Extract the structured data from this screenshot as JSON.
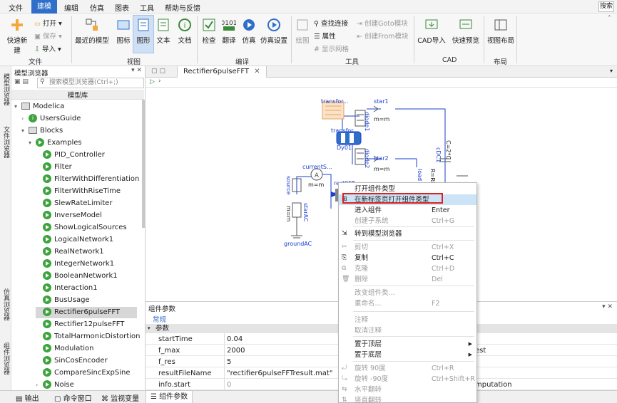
{
  "menu": [
    "文件",
    "建模",
    "编辑",
    "仿真",
    "图表",
    "工具",
    "帮助与反馈"
  ],
  "menu_active": "建模",
  "search_label": "搜索",
  "ribbon": {
    "quick_new": "快速新建",
    "open": "打开",
    "save": "保存",
    "import": "导入",
    "recent_models": "最近的模型",
    "icon": "图标",
    "diagram": "图形",
    "text": "文本",
    "docs": "文档",
    "check": "检查",
    "translate": "翻译",
    "simulate": "仿真",
    "sim_settings": "仿真设置",
    "draw": "绘图",
    "find_connection": "查找连接",
    "properties": "属性",
    "show_grid": "显示网格",
    "create_goto": "创建Goto模块",
    "create_from": "创建From模块",
    "cad_import": "CAD导入",
    "quick_preview": "快速预览",
    "view_layout": "视图布局",
    "group_file": "文件",
    "group_view": "视图",
    "group_compile": "编译",
    "group_tools": "工具",
    "group_cad": "CAD",
    "group_layout": "布局"
  },
  "vtabs": [
    "模型浏览器",
    "文件浏览器",
    "仿真浏览器",
    "组件浏览器"
  ],
  "browser": {
    "title": "模型浏览器",
    "search_placeholder": "搜索模型浏览器(Ctrl+;)",
    "lib_header": "模型库",
    "items": [
      {
        "label": "Modelica",
        "kind": "root"
      },
      {
        "label": "UsersGuide",
        "kind": "info"
      },
      {
        "label": "Blocks",
        "kind": "pkg"
      },
      {
        "label": "Examples",
        "kind": "play"
      },
      {
        "label": "PID_Controller",
        "kind": "play"
      },
      {
        "label": "Filter",
        "kind": "play"
      },
      {
        "label": "FilterWithDifferentiation",
        "kind": "play"
      },
      {
        "label": "FilterWithRiseTime",
        "kind": "play"
      },
      {
        "label": "SlewRateLimiter",
        "kind": "play"
      },
      {
        "label": "InverseModel",
        "kind": "play"
      },
      {
        "label": "ShowLogicalSources",
        "kind": "play"
      },
      {
        "label": "LogicalNetwork1",
        "kind": "play"
      },
      {
        "label": "RealNetwork1",
        "kind": "play"
      },
      {
        "label": "IntegerNetwork1",
        "kind": "play"
      },
      {
        "label": "BooleanNetwork1",
        "kind": "play"
      },
      {
        "label": "Interaction1",
        "kind": "play"
      },
      {
        "label": "BusUsage",
        "kind": "play"
      },
      {
        "label": "Rectifier6pulseFFT",
        "kind": "play"
      },
      {
        "label": "Rectifier12pulseFFT",
        "kind": "play"
      },
      {
        "label": "TotalHarmonicDistortion",
        "kind": "play"
      },
      {
        "label": "Modulation",
        "kind": "play"
      },
      {
        "label": "SinCosEncoder",
        "kind": "play"
      },
      {
        "label": "CompareSincExpSine",
        "kind": "play"
      },
      {
        "label": "Noise",
        "kind": "play"
      }
    ]
  },
  "editor": {
    "tab": "Rectifier6pulseFFT"
  },
  "diagram": {
    "transformer1": "transfor...",
    "transformer2": "transfor...",
    "dy01": "Dy01",
    "star1": "star1",
    "star2": "star2",
    "m_m_1": "m=m",
    "m_m_2": "m=m",
    "m_m_3": "m=m",
    "m_m_4": "m=m",
    "diode1": "diode1",
    "diode2": "diode2",
    "current": "currentS...",
    "source": "source",
    "starAC": "starAC",
    "groundAC": "groundAC",
    "rectFFT": "rectFFT",
    "load": "load",
    "rerl": "R=RL",
    "cdc1": "cDC1",
    "c2c": "C=2*C"
  },
  "params": {
    "header": "组件参数",
    "subtab": "常规",
    "section": "参数",
    "rows": [
      {
        "name": "startTime",
        "value": "0.04",
        "comment": ""
      },
      {
        "name": "f_max",
        "value": "2000",
        "comment": "est"
      },
      {
        "name": "f_res",
        "value": "5",
        "comment": ""
      },
      {
        "name": "resultFileName",
        "value": "\"rectifier6pulseFFTresult.mat\"",
        "comment": ""
      },
      {
        "name": "info.start",
        "value": "0",
        "comment": "mputation"
      }
    ]
  },
  "bottom_tabs": [
    "输出",
    "命令窗口",
    "监视变量",
    "组件参数"
  ],
  "context_menu": [
    {
      "label": "打开组件类型",
      "shortcut": "",
      "state": "normal"
    },
    {
      "label": "在新标签页打开组件类型",
      "shortcut": "",
      "state": "highlight"
    },
    {
      "label": "进入组件",
      "shortcut": "Enter",
      "state": "normal"
    },
    {
      "label": "创建子系统",
      "shortcut": "Ctrl+G",
      "state": "disabled"
    },
    {
      "label": "转到模型浏览器",
      "shortcut": "",
      "state": "normal"
    },
    {
      "label": "剪切",
      "shortcut": "Ctrl+X",
      "state": "disabled"
    },
    {
      "label": "复制",
      "shortcut": "Ctrl+C",
      "state": "normal"
    },
    {
      "label": "克隆",
      "shortcut": "Ctrl+D",
      "state": "disabled"
    },
    {
      "label": "删除",
      "shortcut": "Del",
      "state": "disabled"
    },
    {
      "label": "改变组件类...",
      "shortcut": "",
      "state": "disabled"
    },
    {
      "label": "重命名...",
      "shortcut": "F2",
      "state": "disabled"
    },
    {
      "label": "注释",
      "shortcut": "",
      "state": "disabled"
    },
    {
      "label": "取消注释",
      "shortcut": "",
      "state": "disabled"
    },
    {
      "label": "置于顶层",
      "shortcut": "",
      "state": "normal"
    },
    {
      "label": "置于底层",
      "shortcut": "",
      "state": "normal"
    },
    {
      "label": "旋转 90度",
      "shortcut": "Ctrl+R",
      "state": "disabled"
    },
    {
      "label": "旋转 -90度",
      "shortcut": "Ctrl+Shift+R",
      "state": "disabled"
    },
    {
      "label": "水平翻转",
      "shortcut": "",
      "state": "disabled"
    },
    {
      "label": "竖直翻转",
      "shortcut": "",
      "state": "disabled"
    }
  ],
  "colors": {
    "accent": "#2f6fc9",
    "highlight_box": "#dd2222",
    "diagram_blue": "#1a3fd1"
  }
}
